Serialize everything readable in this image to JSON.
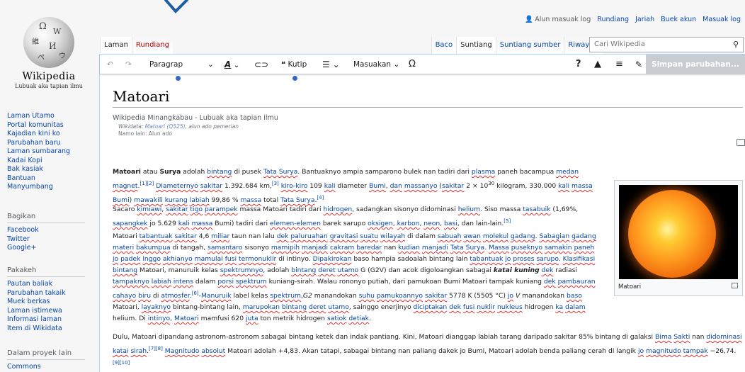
{
  "logo": {
    "wordmark": "Wikipedia",
    "tagline": "Lubuak aka tapian ilmu"
  },
  "sidebar": {
    "nav": [
      "Laman Utamo",
      "Portal komunitas",
      "Kajadian kini ko",
      "Parubahan baru",
      "Laman sumbarang",
      "Kadai Kopi",
      "Bak kasiak",
      "Bantuan",
      "Manyumbang"
    ],
    "share_heading": "Bagikan",
    "share": [
      "Facebook",
      "Twitter",
      "Google+"
    ],
    "tools_heading": "Pakakeh",
    "tools": [
      "Pautan baliak",
      "Parubahan takaik",
      "Muek berkas",
      "Laman istimewa",
      "Informasi laman",
      "Item di Wikidata"
    ],
    "projects_heading": "Dalam proyek lain",
    "projects": [
      "Commons"
    ]
  },
  "personal": {
    "not_logged": "Alun masuak log",
    "links": [
      "Rundiang",
      "Jariah",
      "Buek akun",
      "Masuak log"
    ]
  },
  "tabs": {
    "left": [
      "Laman",
      "Rundiang"
    ],
    "right": [
      "Baco",
      "Suntiang",
      "Suntiang sumber",
      "Riwayaik"
    ]
  },
  "search": {
    "placeholder": "Cari Wikipedia"
  },
  "toolbar": {
    "paragraph": "Paragrap",
    "cite": "Kutip",
    "insert": "Masuakan",
    "save": "Simpan parubahan..."
  },
  "page": {
    "title": "Matoari",
    "site_sub": "Wikipedia Minangkabau - Lubuak aka tapian ilmu",
    "wikidata_label": "Wikidata: ",
    "wikidata_link": "Matoari (Q525)",
    "wikidata_suffix": ", alun ado pemerian",
    "alias": "Namo lain: Alun ado"
  },
  "infobox": {
    "caption": "Matoari"
  }
}
